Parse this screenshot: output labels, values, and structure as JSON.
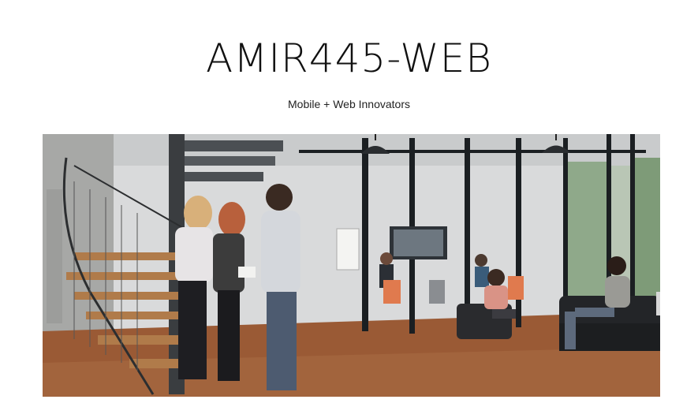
{
  "site": {
    "title": "AMIR445-WEB",
    "tagline": "Mobile + Web Innovators"
  },
  "hero": {
    "image_description": "",
    "icon": "office-photo"
  },
  "colors": {
    "floor": "#9a5a35",
    "wall": "#d9dadb",
    "frame": "#1b1f22",
    "accent_chair": "#e07a4e"
  }
}
